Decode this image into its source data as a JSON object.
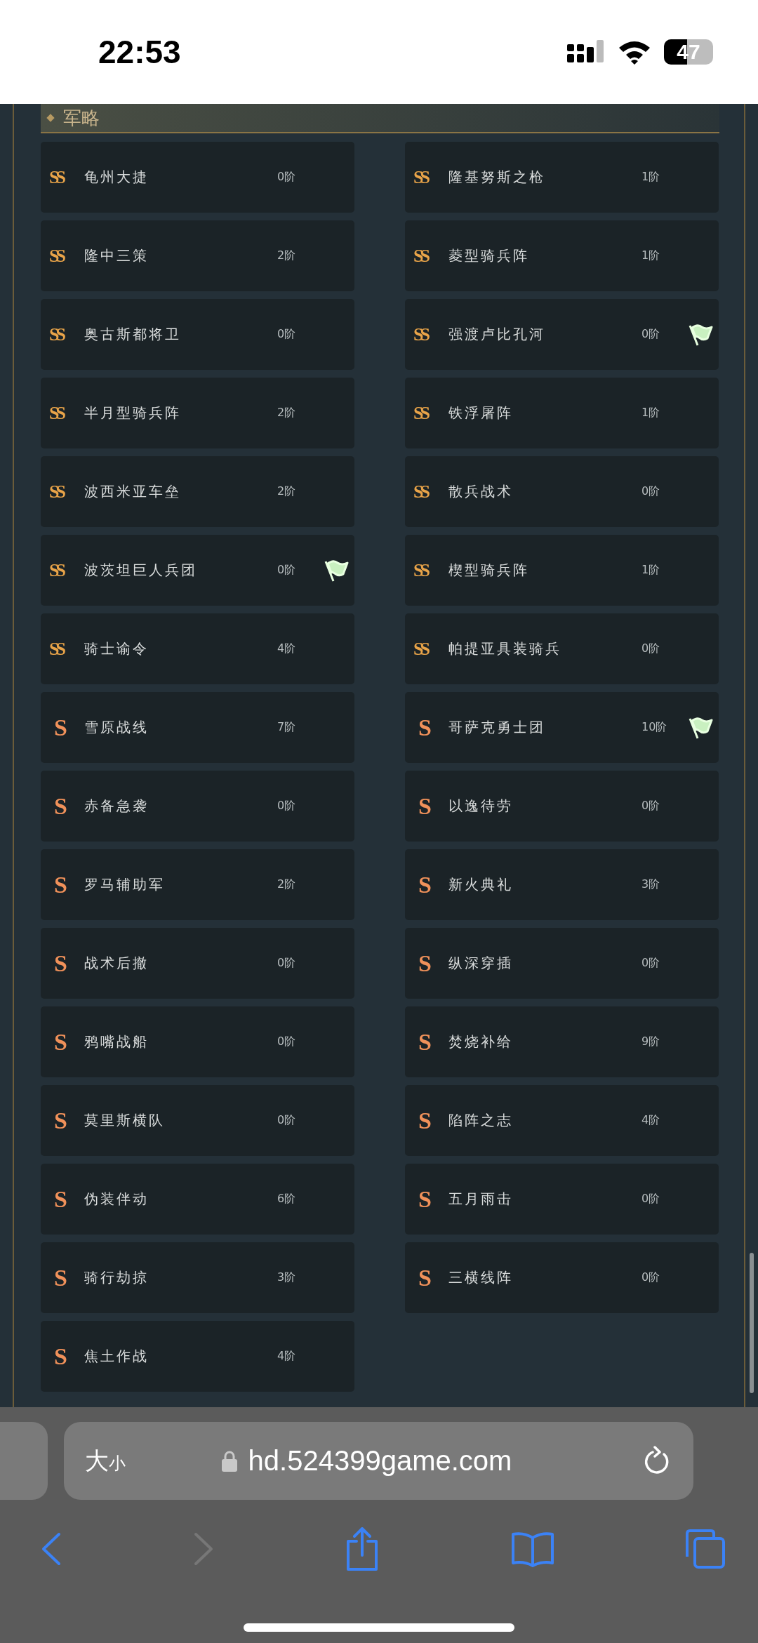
{
  "status_bar": {
    "time": "22:53",
    "battery": "47"
  },
  "section": {
    "title": "军略"
  },
  "tactics": [
    {
      "grade": "SS",
      "name": "龟州大捷",
      "tier": "0阶",
      "flag": false
    },
    {
      "grade": "SS",
      "name": "隆基努斯之枪",
      "tier": "1阶",
      "flag": false
    },
    {
      "grade": "SS",
      "name": "隆中三策",
      "tier": "2阶",
      "flag": false
    },
    {
      "grade": "SS",
      "name": "菱型骑兵阵",
      "tier": "1阶",
      "flag": false
    },
    {
      "grade": "SS",
      "name": "奥古斯都将卫",
      "tier": "0阶",
      "flag": false
    },
    {
      "grade": "SS",
      "name": "强渡卢比孔河",
      "tier": "0阶",
      "flag": true
    },
    {
      "grade": "SS",
      "name": "半月型骑兵阵",
      "tier": "2阶",
      "flag": false
    },
    {
      "grade": "SS",
      "name": "铁浮屠阵",
      "tier": "1阶",
      "flag": false
    },
    {
      "grade": "SS",
      "name": "波西米亚车垒",
      "tier": "2阶",
      "flag": false
    },
    {
      "grade": "SS",
      "name": "散兵战术",
      "tier": "0阶",
      "flag": false
    },
    {
      "grade": "SS",
      "name": "波茨坦巨人兵团",
      "tier": "0阶",
      "flag": true
    },
    {
      "grade": "SS",
      "name": "楔型骑兵阵",
      "tier": "1阶",
      "flag": false
    },
    {
      "grade": "SS",
      "name": "骑士谕令",
      "tier": "4阶",
      "flag": false
    },
    {
      "grade": "SS",
      "name": "帕提亚具装骑兵",
      "tier": "0阶",
      "flag": false
    },
    {
      "grade": "S",
      "name": "雪原战线",
      "tier": "7阶",
      "flag": false
    },
    {
      "grade": "S",
      "name": "哥萨克勇士团",
      "tier": "10阶",
      "flag": true
    },
    {
      "grade": "S",
      "name": "赤备急袭",
      "tier": "0阶",
      "flag": false
    },
    {
      "grade": "S",
      "name": "以逸待劳",
      "tier": "0阶",
      "flag": false
    },
    {
      "grade": "S",
      "name": "罗马辅助军",
      "tier": "2阶",
      "flag": false
    },
    {
      "grade": "S",
      "name": "新火典礼",
      "tier": "3阶",
      "flag": false
    },
    {
      "grade": "S",
      "name": "战术后撤",
      "tier": "0阶",
      "flag": false
    },
    {
      "grade": "S",
      "name": "纵深穿插",
      "tier": "0阶",
      "flag": false
    },
    {
      "grade": "S",
      "name": "鸦嘴战船",
      "tier": "0阶",
      "flag": false
    },
    {
      "grade": "S",
      "name": "焚烧补给",
      "tier": "9阶",
      "flag": false
    },
    {
      "grade": "S",
      "name": "莫里斯横队",
      "tier": "0阶",
      "flag": false
    },
    {
      "grade": "S",
      "name": "陷阵之志",
      "tier": "4阶",
      "flag": false
    },
    {
      "grade": "S",
      "name": "伪装伴动",
      "tier": "6阶",
      "flag": false
    },
    {
      "grade": "S",
      "name": "五月雨击",
      "tier": "0阶",
      "flag": false
    },
    {
      "grade": "S",
      "name": "骑行劫掠",
      "tier": "3阶",
      "flag": false
    },
    {
      "grade": "S",
      "name": "三横线阵",
      "tier": "0阶",
      "flag": false
    },
    {
      "grade": "S",
      "name": "焦土作战",
      "tier": "4阶",
      "flag": false
    }
  ],
  "browser": {
    "text_size": "大",
    "text_size_small": "小",
    "url": "hd.524399game.com"
  }
}
